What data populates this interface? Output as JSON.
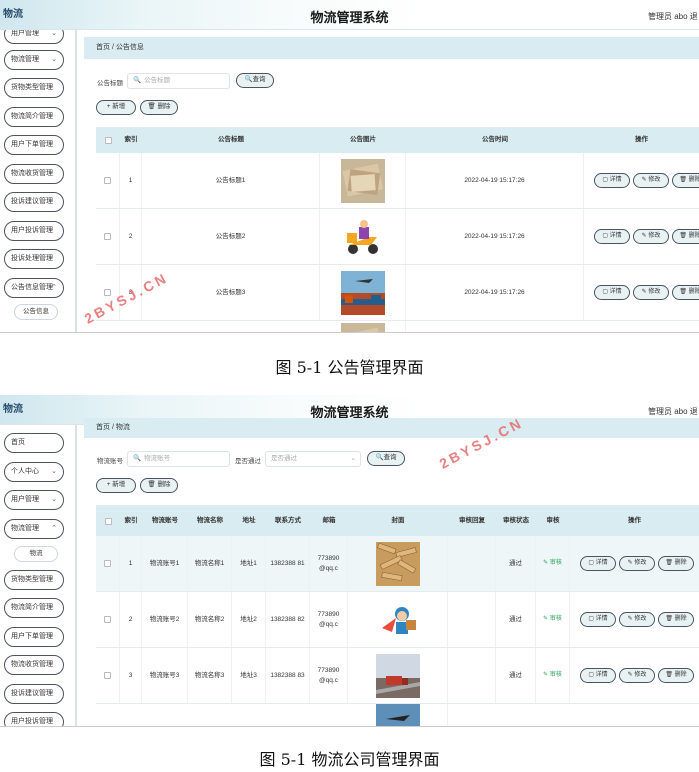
{
  "screenshot1": {
    "logo": "物流",
    "title": "物流管理系统",
    "admin": "管理员 abo  退",
    "sidebar": [
      {
        "label": "用户管理",
        "chevron": "⌄"
      },
      {
        "label": "物流管理",
        "chevron": "⌄"
      },
      {
        "label": "货物类型管理",
        "chevron": ""
      },
      {
        "label": "物流简介管理",
        "chevron": ""
      },
      {
        "label": "用户下单管理",
        "chevron": ""
      },
      {
        "label": "物流收货管理",
        "chevron": ""
      },
      {
        "label": "投诉建议管理",
        "chevron": ""
      },
      {
        "label": "用户投诉管理",
        "chevron": ""
      },
      {
        "label": "投诉处理管理",
        "chevron": ""
      },
      {
        "label": "公告信息管理",
        "chevron": "⌃"
      },
      {
        "label": "公告信息",
        "chevron": ""
      }
    ],
    "breadcrumb": {
      "home": "首页",
      "sep": "/",
      "current": "公告信息"
    },
    "filter": {
      "label": "公告标题",
      "placeholder": "公告标题",
      "query": "查询"
    },
    "actions": {
      "add": "+ 新增",
      "delete": "🗑 删除"
    },
    "columns": [
      "",
      "索引",
      "公告标题",
      "公告图片",
      "公告时间",
      "操作"
    ],
    "rows": [
      {
        "index": "1",
        "title": "公告标题1",
        "image": "money-photo",
        "time": "2022-04-19 15:17:26"
      },
      {
        "index": "2",
        "title": "公告标题2",
        "image": "delivery-scooter-photo",
        "time": "2022-04-19 15:17:26"
      },
      {
        "index": "3",
        "title": "公告标题3",
        "image": "port-plane-photo",
        "time": "2022-04-19 15:17:26"
      }
    ],
    "row_buttons": {
      "detail": "详情",
      "edit": "修改",
      "delete": "删除"
    },
    "caption": "图 5-1  公告管理界面"
  },
  "screenshot2": {
    "logo": "物流",
    "title": "物流管理系统",
    "admin": "管理员 abo  退",
    "sidebar": [
      {
        "label": "首页",
        "chevron": ""
      },
      {
        "label": "个人中心",
        "chevron": "⌄"
      },
      {
        "label": "用户管理",
        "chevron": "⌄"
      },
      {
        "label": "物流管理",
        "chevron": "⌃"
      },
      {
        "label": "物流",
        "chevron": ""
      },
      {
        "label": "货物类型管理",
        "chevron": ""
      },
      {
        "label": "物流简介管理",
        "chevron": ""
      },
      {
        "label": "用户下单管理",
        "chevron": ""
      },
      {
        "label": "物流收货管理",
        "chevron": ""
      },
      {
        "label": "投诉建议管理",
        "chevron": ""
      },
      {
        "label": "用户投诉管理",
        "chevron": ""
      }
    ],
    "breadcrumb": {
      "home": "首页",
      "sep": "/",
      "current": "物流"
    },
    "filter": {
      "label": "物流账号",
      "placeholder": "物流账号",
      "label2": "是否通过",
      "placeholder2": "是否通过",
      "query": "查询"
    },
    "actions": {
      "add": "+ 新增",
      "delete": "🗑 删除"
    },
    "columns": [
      "",
      "索引",
      "物流账号",
      "物流名称",
      "地址",
      "联系方式",
      "邮箱",
      "封面",
      "审核回复",
      "审核状态",
      "审核",
      "操作"
    ],
    "rows": [
      {
        "index": "1",
        "account": "物流账号1",
        "name": "物流名称1",
        "address": "地址1",
        "phone": "1382388 81",
        "email": "773890 @qq.c",
        "cover": "wood-photo",
        "reply": "",
        "status": "通过",
        "review": "✎ 审核"
      },
      {
        "index": "2",
        "account": "物流账号2",
        "name": "物流名称2",
        "address": "地址2",
        "phone": "1382388 82",
        "email": "773890 @qq.c",
        "cover": "courier-cartoon",
        "reply": "",
        "status": "通过",
        "review": "✎ 审核"
      },
      {
        "index": "3",
        "account": "物流账号3",
        "name": "物流名称3",
        "address": "地址3",
        "phone": "1382388 83",
        "email": "773890 @qq.c",
        "cover": "truck-road-photo",
        "reply": "",
        "status": "通过",
        "review": "✎ 审核"
      }
    ],
    "row_buttons": {
      "detail": "详情",
      "edit": "修改",
      "delete": "删除"
    },
    "caption": "图 5-1  物流公司管理界面"
  },
  "watermark": "2BYSJ.CN",
  "colors": {
    "header_bg": "#d9ecf1",
    "pill_border": "#4a5560",
    "watermark": "#e56a6a",
    "review_green": "#2aa05a"
  }
}
